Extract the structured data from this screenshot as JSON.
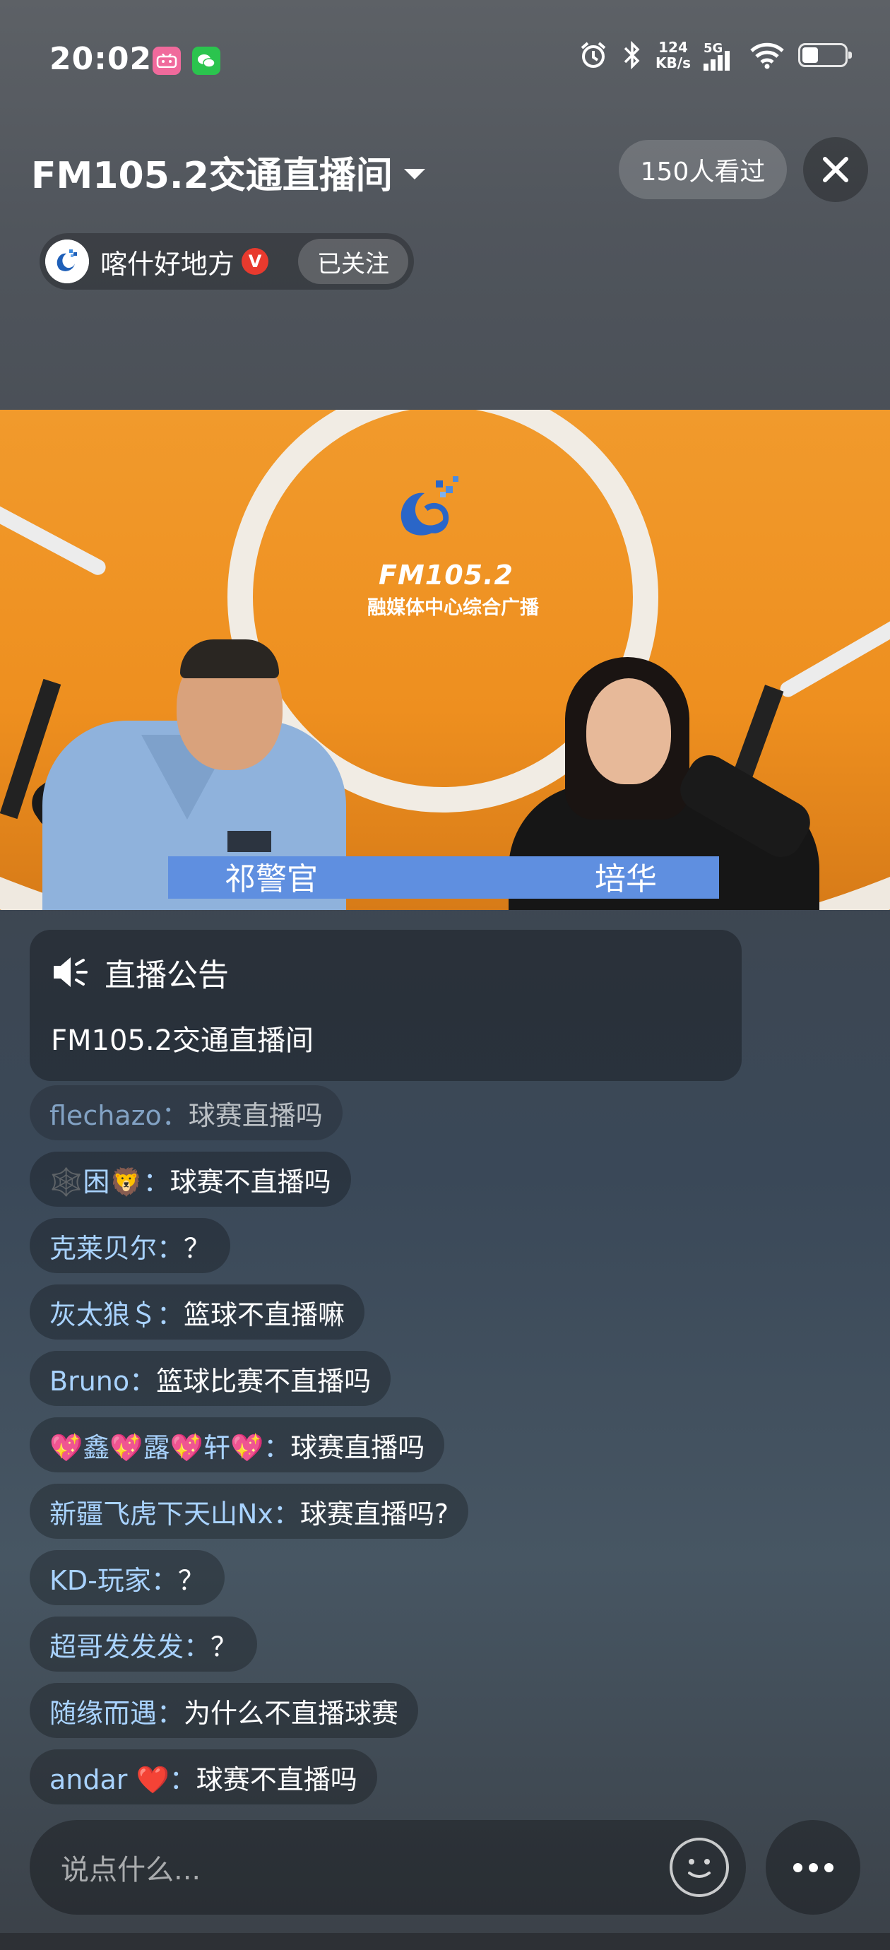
{
  "status_bar": {
    "time": "20:02",
    "apps": [
      "bilibili-icon",
      "wechat-icon"
    ],
    "net_speed_value": "124",
    "net_speed_unit": "KB/s",
    "network": "5G",
    "icons": [
      "alarm-icon",
      "bluetooth-icon",
      "signal-icon",
      "wifi-icon",
      "battery-icon"
    ]
  },
  "header": {
    "title": "FM105.2交通直播间",
    "viewers": "150人看过",
    "host_name": "喀什好地方",
    "verified_mark": "V",
    "follow_label": "已关注"
  },
  "video": {
    "station_brand": "FM105.2",
    "station_sub": "融媒体中心综合广播",
    "name_left": "祁警官",
    "name_right": "培华"
  },
  "announcement": {
    "heading": "直播公告",
    "body": "FM105.2交通直播间"
  },
  "chat": [
    {
      "user": "flechazo：",
      "msg": "球赛直播吗"
    },
    {
      "user": "🕸️困🦁：",
      "msg": "球赛不直播吗"
    },
    {
      "user": "克莱贝尔：",
      "msg": "？"
    },
    {
      "user": "灰太狼＄：",
      "msg": "篮球不直播嘛"
    },
    {
      "user": "Bruno：",
      "msg": "篮球比赛不直播吗"
    },
    {
      "user": "💖鑫💖露💖轩💖：",
      "msg": "球赛直播吗"
    },
    {
      "user": "新疆飞虎下天山Nx：",
      "msg": "球赛直播吗?"
    },
    {
      "user": "KD-玩家：",
      "msg": "？"
    },
    {
      "user": "超哥发发发：",
      "msg": "？"
    },
    {
      "user": "随缘而遇：",
      "msg": "为什么不直播球赛"
    },
    {
      "user": "andar ❤️：",
      "msg": "球赛不直播吗"
    }
  ],
  "input": {
    "placeholder": "说点什么..."
  }
}
